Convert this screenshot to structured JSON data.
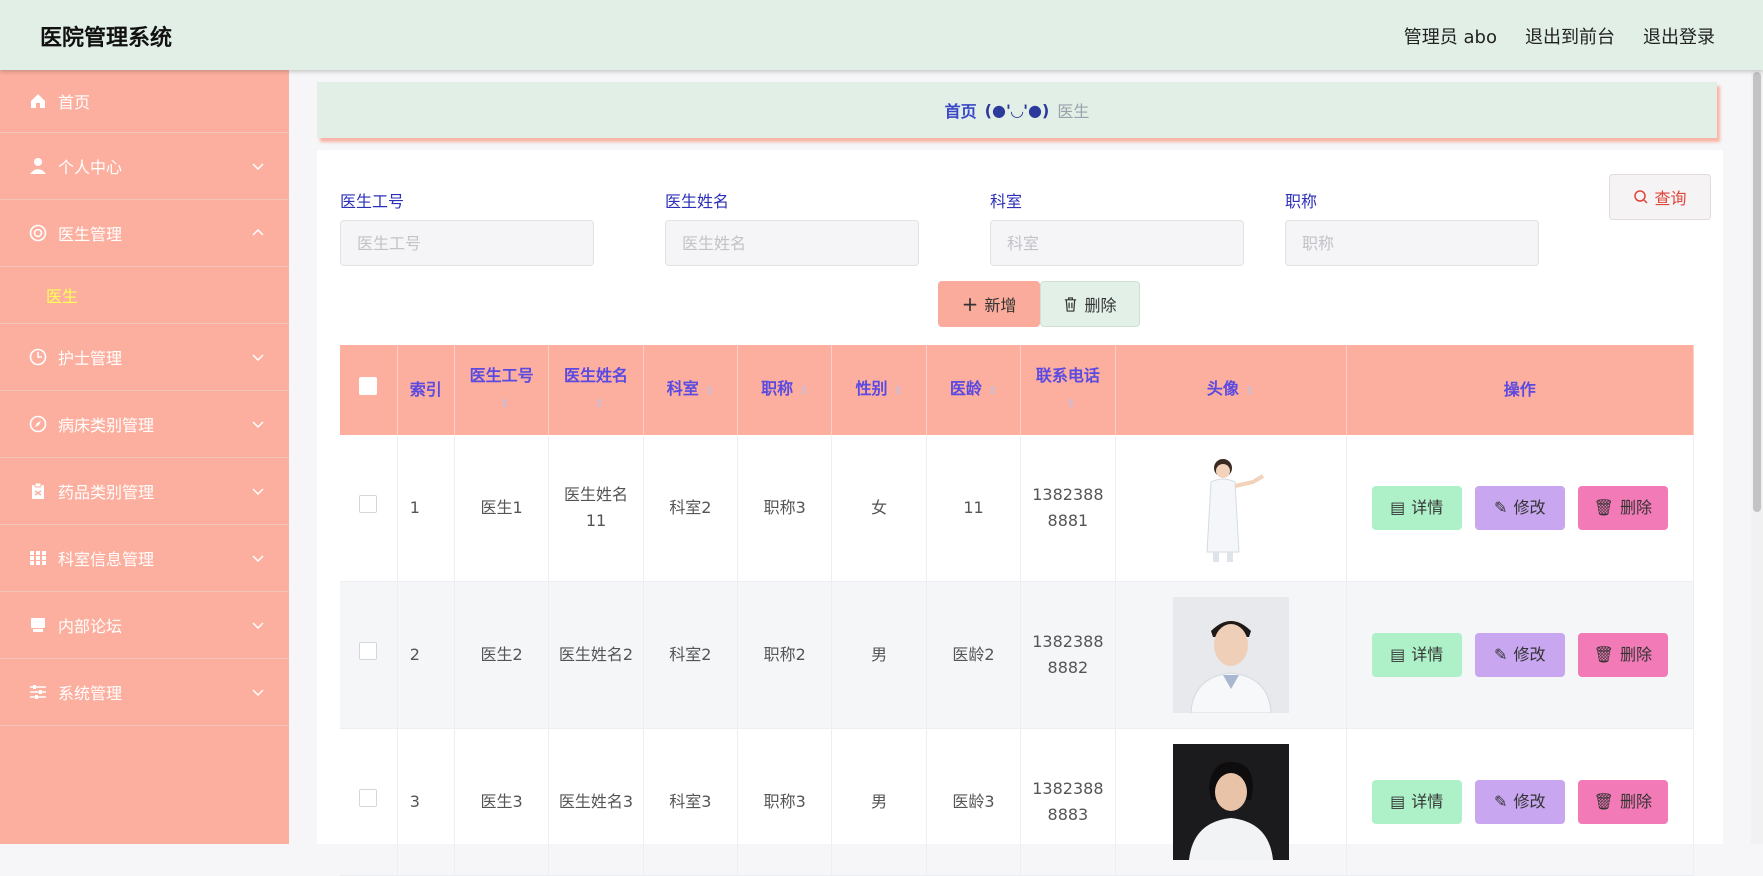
{
  "app": {
    "title": "医院管理系统"
  },
  "header": {
    "user_label": "管理员 abo",
    "front_label": "退出到前台",
    "logout_label": "退出登录"
  },
  "sidebar": {
    "items": [
      {
        "label": "首页",
        "icon": "home-icon"
      },
      {
        "label": "个人中心",
        "icon": "user-icon"
      },
      {
        "label": "医生管理",
        "icon": "lifebuoy-icon",
        "expanded": true,
        "children": [
          {
            "label": "医生",
            "active": true
          }
        ]
      },
      {
        "label": "护士管理",
        "icon": "clock-icon"
      },
      {
        "label": "病床类别管理",
        "icon": "compass-icon"
      },
      {
        "label": "药品类别管理",
        "icon": "clipboard-icon"
      },
      {
        "label": "科室信息管理",
        "icon": "grid-icon"
      },
      {
        "label": "内部论坛",
        "icon": "monitor-icon"
      },
      {
        "label": "系统管理",
        "icon": "sliders-icon"
      }
    ]
  },
  "breadcrumb": {
    "home": "首页",
    "face": "(●'◡'●)",
    "current": "医生"
  },
  "search": {
    "fields": [
      {
        "label": "医生工号",
        "placeholder": "医生工号"
      },
      {
        "label": "医生姓名",
        "placeholder": "医生姓名"
      },
      {
        "label": "科室",
        "placeholder": "科室"
      },
      {
        "label": "职称",
        "placeholder": "职称"
      }
    ],
    "button": "查询"
  },
  "actions": {
    "add": "新增",
    "delete": "删除"
  },
  "table": {
    "columns": [
      "索引",
      "医生工号",
      "医生姓名",
      "科室",
      "职称",
      "性别",
      "医龄",
      "联系电话",
      "头像",
      "操作"
    ],
    "rows": [
      {
        "index": "1",
        "id": "医生1",
        "name": "医生姓名11",
        "dept": "科室2",
        "title": "职称3",
        "gender": "女",
        "age": "11",
        "phone": "13823888881"
      },
      {
        "index": "2",
        "id": "医生2",
        "name": "医生姓名2",
        "dept": "科室2",
        "title": "职称2",
        "gender": "男",
        "age": "医龄2",
        "phone": "13823888882"
      },
      {
        "index": "3",
        "id": "医生3",
        "name": "医生姓名3",
        "dept": "科室3",
        "title": "职称3",
        "gender": "男",
        "age": "医龄3",
        "phone": "13823888883"
      }
    ],
    "row_actions": {
      "detail": "详情",
      "edit": "修改",
      "remove": "删除"
    }
  },
  "colors": {
    "sidebar": "#fdaf9f",
    "header": "#e1efe7",
    "accent": "#5b4ae0",
    "detail": "#aef1c8",
    "edit": "#c8a6f0",
    "remove": "#f27ab6"
  }
}
